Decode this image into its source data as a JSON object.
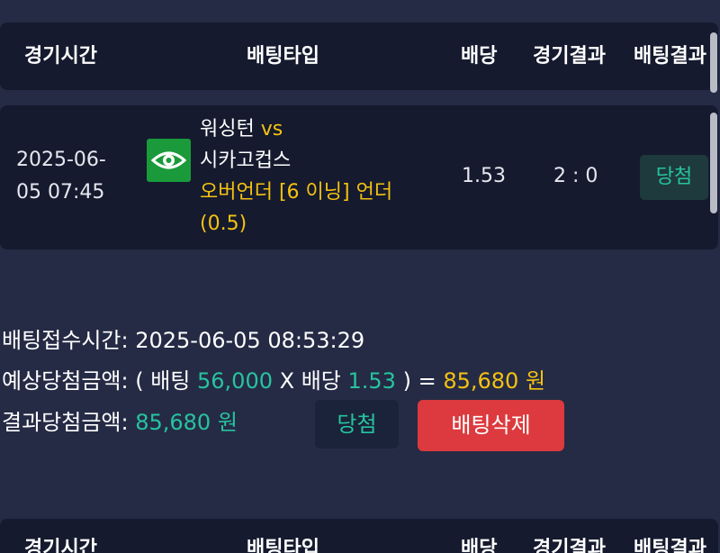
{
  "header": {
    "col_time": "경기시간",
    "col_bettype": "배팅타입",
    "col_odds": "배당",
    "col_game_result": "경기결과",
    "col_bet_result": "배팅결과"
  },
  "bet_row": {
    "time_date": "2025-06-",
    "time_rest": "05 07:45",
    "team_home": "워싱턴",
    "vs": "vs",
    "team_away": "시카고컵스",
    "bet_type": "오버언더 [6 이닝] 언더",
    "bet_pick": "(0.5)",
    "odds": "1.53",
    "score": "2 : 0",
    "result": "당첨"
  },
  "summary": {
    "received_label": "배팅접수시간:",
    "received_value": "2025-06-05 08:53:29",
    "expected_label": "예상당첨금액:",
    "expected_open": "( 배팅",
    "expected_stake": "56,000",
    "expected_x": "X 배당",
    "expected_odds": "1.53",
    "expected_close": ") =",
    "expected_amount": "85,680 원",
    "actual_label": "결과당첨금액:",
    "actual_amount": "85,680 원"
  },
  "buttons": {
    "win_label": "당첨",
    "delete_label": "배팅삭제"
  },
  "colors": {
    "background": "#252b45",
    "panel": "#151a2e",
    "green": "#27c3a0",
    "gold": "#f5c211",
    "red": "#dc3a3e",
    "eye_badge": "#1a9a3a"
  },
  "icons": {
    "game_icon": "eye-icon"
  }
}
